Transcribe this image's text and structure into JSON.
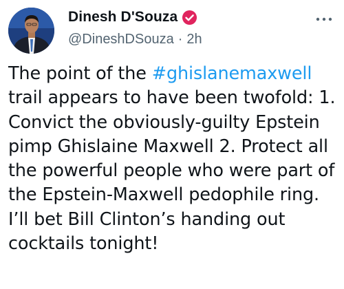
{
  "author": {
    "display_name": "Dinesh D'Souza",
    "handle": "@DineshDSouza",
    "separator": "·",
    "timestamp": "2h",
    "verified": true,
    "avatar_icon": "profile-photo"
  },
  "menu_icon": "more-options-icon",
  "tweet": {
    "text_before": "The point of the ",
    "hashtag": "#ghislanemaxwell",
    "text_after": " trail appears to have been twofold: 1. Convict the obviously-guilty Epstein pimp Ghislaine Maxwell 2. Protect all the powerful people who were part of the Epstein-Maxwell pedophile ring. I’ll bet Bill Clinton’s handing out cocktails tonight!"
  },
  "colors": {
    "text": "#0f1419",
    "secondary": "#536471",
    "link": "#1d9bf0",
    "verified_badge": "#e0245e"
  }
}
